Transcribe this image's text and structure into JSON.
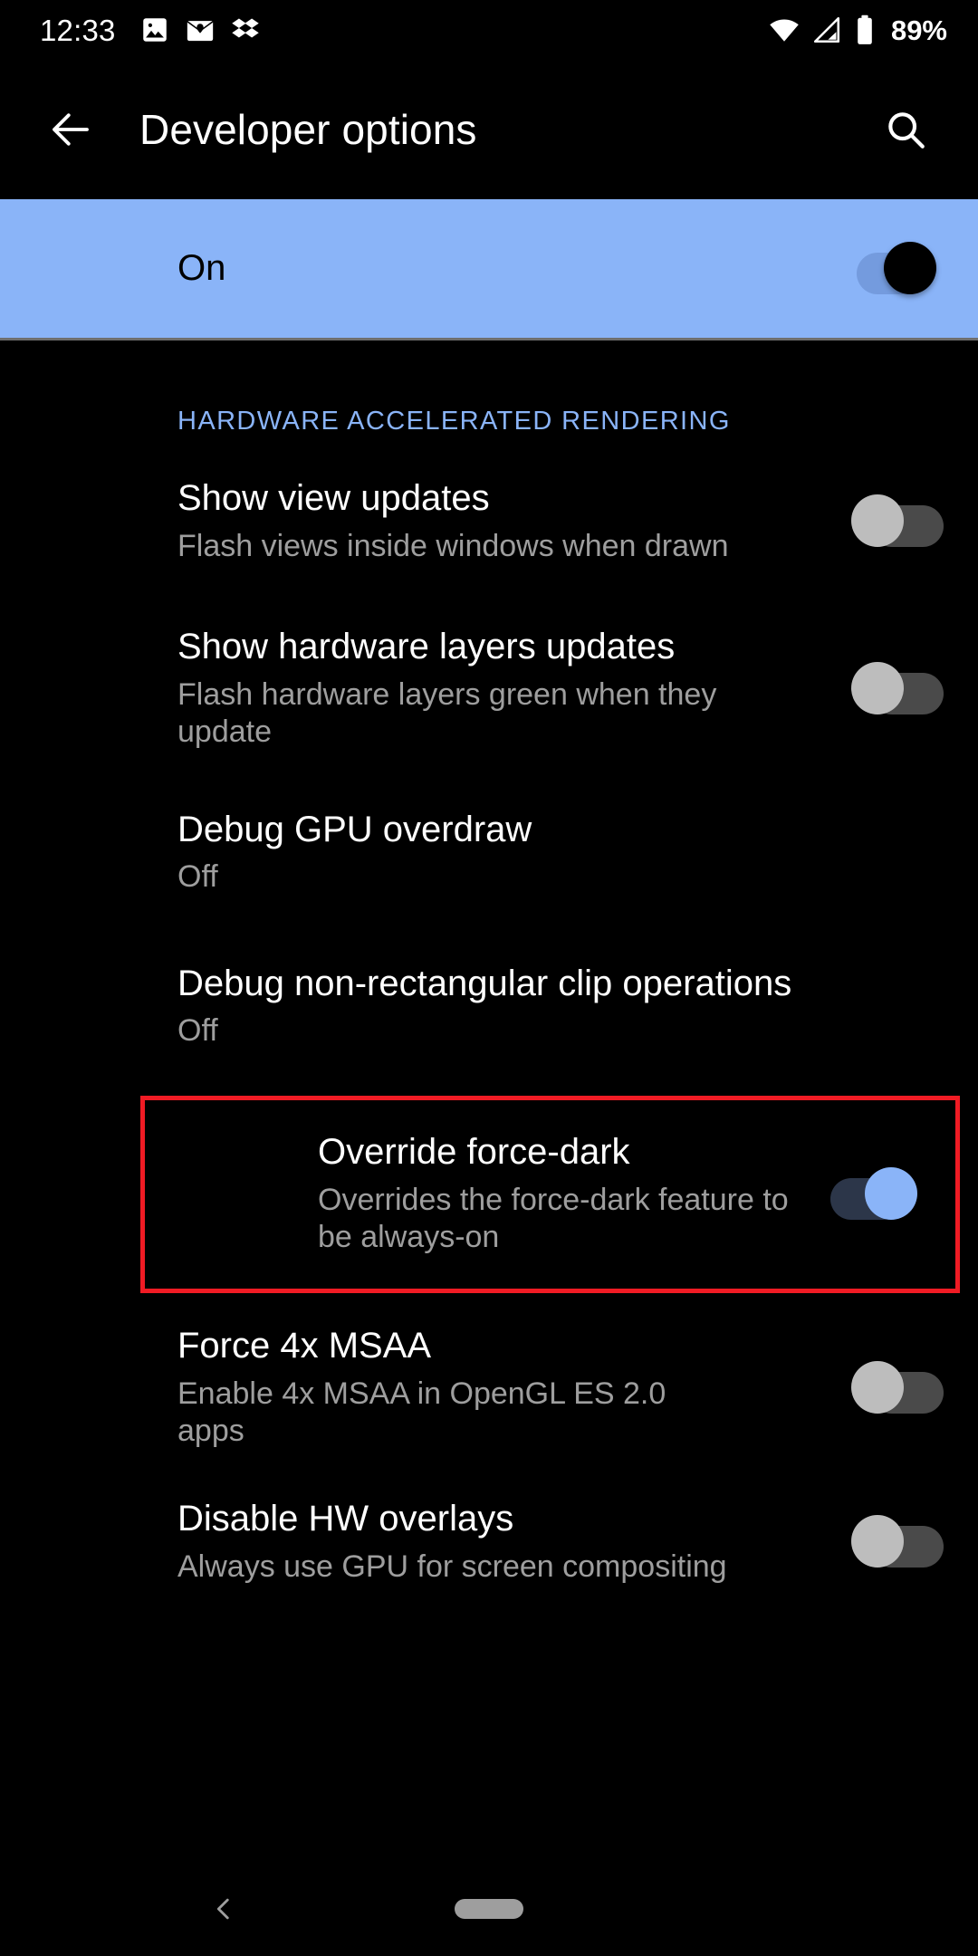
{
  "status_bar": {
    "time": "12:33",
    "battery_percent": "89%",
    "left_icons": [
      "image-icon",
      "mail-icon",
      "dropbox-icon"
    ],
    "right_icons": [
      "wifi-icon",
      "signal-icon",
      "battery-icon"
    ]
  },
  "toolbar": {
    "back_label": "back-arrow",
    "title": "Developer options",
    "search_label": "search"
  },
  "master_switch": {
    "label": "On",
    "state": "on",
    "background_color": "#8ab4f8"
  },
  "section": {
    "header": "HARDWARE ACCELERATED RENDERING",
    "header_color": "#8ab4f8"
  },
  "rows": [
    {
      "title": "Show view updates",
      "summary": "Flash views inside windows when drawn",
      "control": "switch",
      "state": "off"
    },
    {
      "title": "Show hardware layers updates",
      "summary": "Flash hardware layers green when they update",
      "control": "switch",
      "state": "off"
    },
    {
      "title": "Debug GPU overdraw",
      "summary": "Off",
      "control": "none",
      "state": ""
    },
    {
      "title": "Debug non-rectangular clip operations",
      "summary": "Off",
      "control": "none",
      "state": ""
    },
    {
      "title": "Override force-dark",
      "summary": "Overrides the force-dark feature to be always-on",
      "control": "switch",
      "state": "on",
      "highlighted": true,
      "highlight_color": "#f01b24"
    },
    {
      "title": "Force 4x MSAA",
      "summary": "Enable 4x MSAA in OpenGL ES 2.0 apps",
      "control": "switch",
      "state": "off"
    },
    {
      "title": "Disable HW overlays",
      "summary": "Always use GPU for screen compositing",
      "control": "switch",
      "state": "off"
    }
  ],
  "nav_bar": {
    "back": "nav-back-chevron",
    "home": "nav-home-pill"
  },
  "colors": {
    "background": "#000000",
    "accent_blue": "#8ab4f8",
    "summary_text": "#9e9e9e",
    "switch_off_track": "#4a4a4a",
    "switch_off_thumb": "#bdbdbd",
    "switch_on_track": "#2c3649",
    "highlight_red": "#f01b24"
  }
}
